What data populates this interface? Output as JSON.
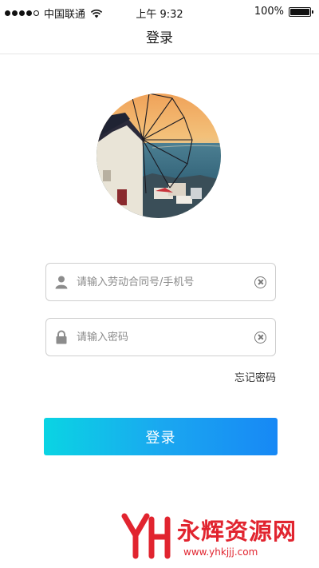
{
  "status_bar": {
    "carrier": "中国联通",
    "time": "上午 9:32",
    "battery": "100%"
  },
  "nav": {
    "title": "登录"
  },
  "form": {
    "account_placeholder": "请输入劳动合同号/手机号",
    "password_placeholder": "请输入密码",
    "forgot_label": "忘记密码",
    "login_label": "登录"
  },
  "watermark": {
    "brand_text": "永辉资源网",
    "url": "www.yhkjjj.com"
  },
  "colors": {
    "button_gradient_start": "#0ad4e3",
    "button_gradient_end": "#1788f5",
    "watermark": "#e1242f"
  },
  "icons": {
    "account": "user-icon",
    "password": "lock-icon",
    "clear": "clear-icon",
    "wifi": "wifi-icon",
    "battery": "battery-icon"
  }
}
